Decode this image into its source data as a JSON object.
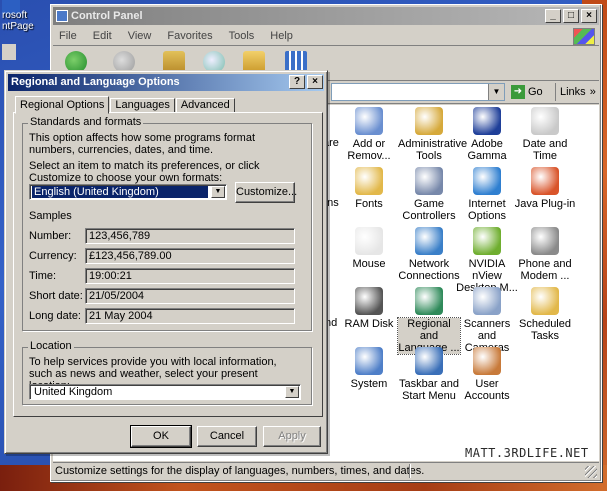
{
  "desktop": {
    "icon_labels": [
      "rosoft\nntPage"
    ],
    "watermark": "MATT.3RDLIFE.NET"
  },
  "control_panel": {
    "title": "Control Panel",
    "window_buttons": [
      "_",
      "□",
      "×"
    ],
    "menu": [
      "File",
      "Edit",
      "View",
      "Favorites",
      "Tools",
      "Help"
    ],
    "address": {
      "go_label": "Go",
      "links_label": "Links",
      "links_chevron": "»"
    },
    "partial_labels": [
      "are",
      "ons",
      "nd"
    ],
    "items": [
      {
        "label": "Add or Remov...",
        "icon": "add-remove-programs-icon",
        "color": "#6a8fd0"
      },
      {
        "label": "Administrative Tools",
        "icon": "administrative-tools-icon",
        "color": "#d6a93b"
      },
      {
        "label": "Adobe Gamma",
        "icon": "adobe-gamma-icon",
        "color": "#1f3f99"
      },
      {
        "label": "Date and Time",
        "icon": "date-time-icon",
        "color": "#c9c9c9"
      },
      {
        "label": "Fonts",
        "icon": "fonts-folder-icon",
        "color": "#e2b84a"
      },
      {
        "label": "Game Controllers",
        "icon": "game-controllers-icon",
        "color": "#7788aa"
      },
      {
        "label": "Internet Options",
        "icon": "internet-options-icon",
        "color": "#2f7fd0"
      },
      {
        "label": "Java Plug-in",
        "icon": "java-plugin-icon",
        "color": "#d9542a"
      },
      {
        "label": "Mouse",
        "icon": "mouse-icon",
        "color": "#e6e6e6"
      },
      {
        "label": "Network Connections",
        "icon": "network-connections-icon",
        "color": "#3a7fc8"
      },
      {
        "label": "NVIDIA nView Desktop M...",
        "icon": "nvidia-nview-icon",
        "color": "#6fae2f"
      },
      {
        "label": "Phone and Modem ...",
        "icon": "phone-modem-icon",
        "color": "#8a8a8a"
      },
      {
        "label": "RAM Disk",
        "icon": "ram-disk-icon",
        "color": "#555555"
      },
      {
        "label": "Regional and Language ...",
        "icon": "regional-language-icon",
        "color": "#2f8a5a"
      },
      {
        "label": "Scanners and Cameras",
        "icon": "scanners-cameras-icon",
        "color": "#8aa2c8"
      },
      {
        "label": "Scheduled Tasks",
        "icon": "scheduled-tasks-icon",
        "color": "#e2b84a"
      },
      {
        "label": "System",
        "icon": "system-icon",
        "color": "#4f7fc8"
      },
      {
        "label": "Taskbar and Start Menu",
        "icon": "taskbar-start-menu-icon",
        "color": "#3a6fb8"
      },
      {
        "label": "User Accounts",
        "icon": "user-accounts-icon",
        "color": "#c87a3a"
      }
    ],
    "status_text": "Customize settings for the display of languages, numbers, times, and dates."
  },
  "dialog": {
    "title": "Regional and Language Options",
    "title_buttons": [
      "?",
      "×"
    ],
    "tabs": [
      "Regional Options",
      "Languages",
      "Advanced"
    ],
    "standards": {
      "group_label": "Standards and formats",
      "description": "This option affects how some programs format numbers, currencies, dates, and time.",
      "instruction": "Select an item to match its preferences, or click Customize to choose your own formats:",
      "selected_format": "English (United Kingdom)",
      "customize_label": "Customize...",
      "samples_label": "Samples",
      "samples": [
        {
          "label": "Number:",
          "value": "123,456,789"
        },
        {
          "label": "Currency:",
          "value": "£123,456,789.00"
        },
        {
          "label": "Time:",
          "value": "19:00:21"
        },
        {
          "label": "Short date:",
          "value": "21/05/2004"
        },
        {
          "label": "Long date:",
          "value": "21 May 2004"
        }
      ]
    },
    "location": {
      "group_label": "Location",
      "description": "To help services provide you with local information, such as news and weather, select your present location:",
      "selected_location": "United Kingdom"
    },
    "buttons": {
      "ok": "OK",
      "cancel": "Cancel",
      "apply": "Apply"
    }
  }
}
